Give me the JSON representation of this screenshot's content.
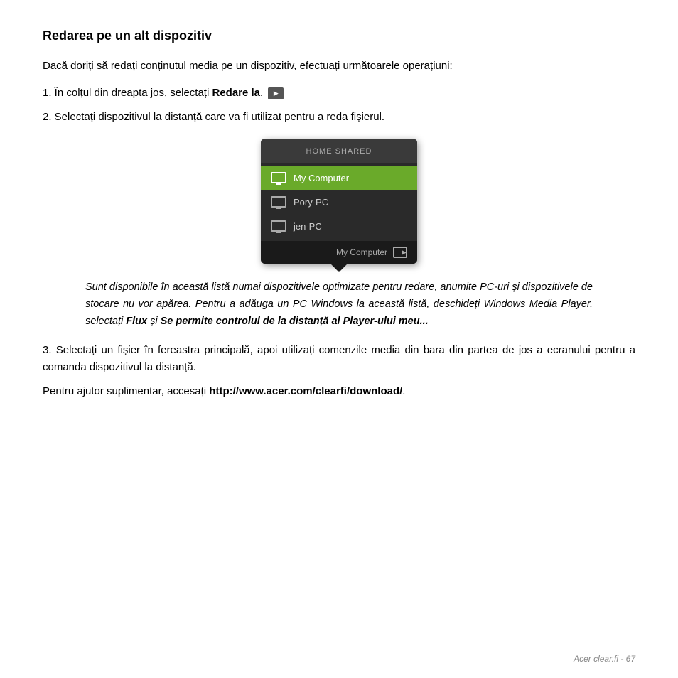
{
  "title": "Redarea pe un alt dispozitiv",
  "paragraph1": "Dacă doriți să redați conținutul media pe un dispozitiv, efectuați următoarele operațiuni:",
  "step1_prefix": "1. În colțul din dreapta jos, selectați ",
  "step1_bold": "Redare la",
  "step2": "2. Selectați dispozitivul la distanță care va fi utilizat pentru a reda fișierul.",
  "widget": {
    "header": "HOME SHARED",
    "items": [
      {
        "label": "My Computer",
        "active": true
      },
      {
        "label": "Pory-PC",
        "active": false
      },
      {
        "label": "jen-PC",
        "active": false
      }
    ],
    "bottom_label": "My Computer"
  },
  "italic_block": "Sunt disponibile în această listă numai dispozitivele optimizate pentru redare, anumite PC-uri și dispozitivele de stocare nu vor apărea. Pentru a adăuga un PC Windows la această listă, deschideți Windows Media Player, selectați ",
  "italic_bold1": "Flux",
  "italic_and": " și ",
  "italic_bold2": "Se permite controlul de la distanță al Player-ului meu...",
  "step3_prefix": "3. Selectați un fișier în fereastra principală, apoi utilizați comenzile media din bara din partea de jos a ecranului pentru a comanda dispozitivul la distanță.",
  "footer_prefix": "Pentru   ajutor   suplimentar,   accesați   ",
  "footer_link": "http://www.acer.com/clearfi/download/",
  "footer_note": "Acer clear.fi -  67"
}
